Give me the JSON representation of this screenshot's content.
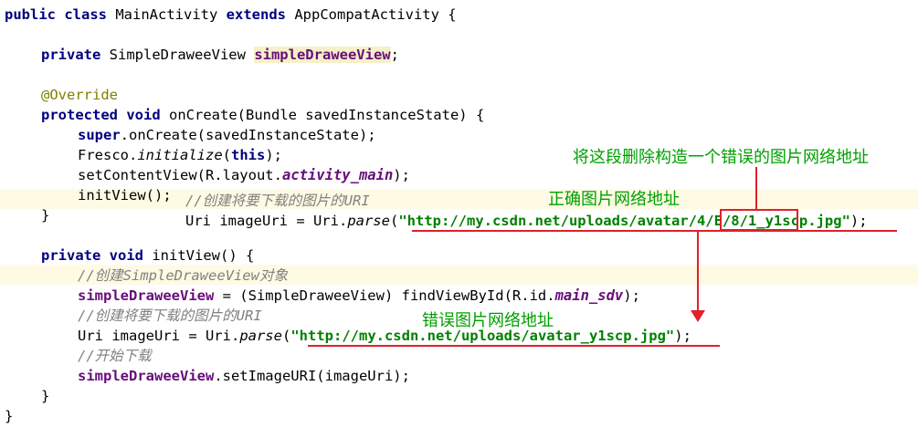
{
  "code": {
    "l1": {
      "kw1": "public",
      "kw2": "class",
      "t1": " MainActivity ",
      "kw3": "extends",
      "t2": " AppCompatActivity {"
    },
    "l2": {
      "kw": "private",
      "type": " SimpleDraweeView ",
      "field": "simpleDraweeView",
      "end": ";"
    },
    "l3": {
      "ann": "@Override"
    },
    "l4": {
      "kw1": "protected",
      "kw2": "void",
      "rest": " onCreate(Bundle savedInstanceState) {"
    },
    "l5": {
      "kw": "super",
      "rest": ".onCreate(savedInstanceState);"
    },
    "l6": {
      "a": "Fresco.",
      "m": "initialize",
      "b": "(",
      "kw": "this",
      "c": ");"
    },
    "l7": {
      "a": "setContentView(R.layout.",
      "f": "activity_main",
      "b": ");"
    },
    "l8": {
      "a": "initView();",
      "comment": "//创建将要下载的图片的URI"
    },
    "l9": {
      "brace": "}",
      "a": "Uri imageUri = Uri.",
      "m": "parse",
      "b": "(",
      "s": "\"http://my.csdn.net/uploads/avatar/4/E/8/1_y1scp.jpg\"",
      "c": ");"
    },
    "l10": {
      "kw1": "private",
      "kw2": "void",
      "rest": " initView() {"
    },
    "l11": {
      "comment": "//创建SimpleDraweeView对象"
    },
    "l12": {
      "f": "simpleDraweeView",
      "a": " = (SimpleDraweeView) findViewById(R.id.",
      "f2": "main_sdv",
      "b": ");"
    },
    "l13": {
      "comment": "//创建将要下载的图片的URI"
    },
    "l14": {
      "a": "Uri imageUri = Uri.",
      "m": "parse",
      "b": "(",
      "s": "\"http://my.csdn.net/uploads/avatar_y1scp.jpg\"",
      "c": ");"
    },
    "l15": {
      "comment": "//开始下载"
    },
    "l16": {
      "f": "simpleDraweeView",
      "a": ".setImageURI(imageUri);"
    },
    "l17": {
      "brace": "}"
    },
    "l18": {
      "brace": "}"
    }
  },
  "annotations": {
    "delete_note": "将这段删除构造一个错误的图片网络地址",
    "correct_label": "正确图片网络地址",
    "wrong_label": "错误图片网络地址"
  },
  "colors": {
    "keyword": "#000080",
    "field": "#660e7a",
    "string": "#008000",
    "comment": "#808080",
    "annotation_text": "#00a000",
    "markup_red": "#e0202a"
  }
}
